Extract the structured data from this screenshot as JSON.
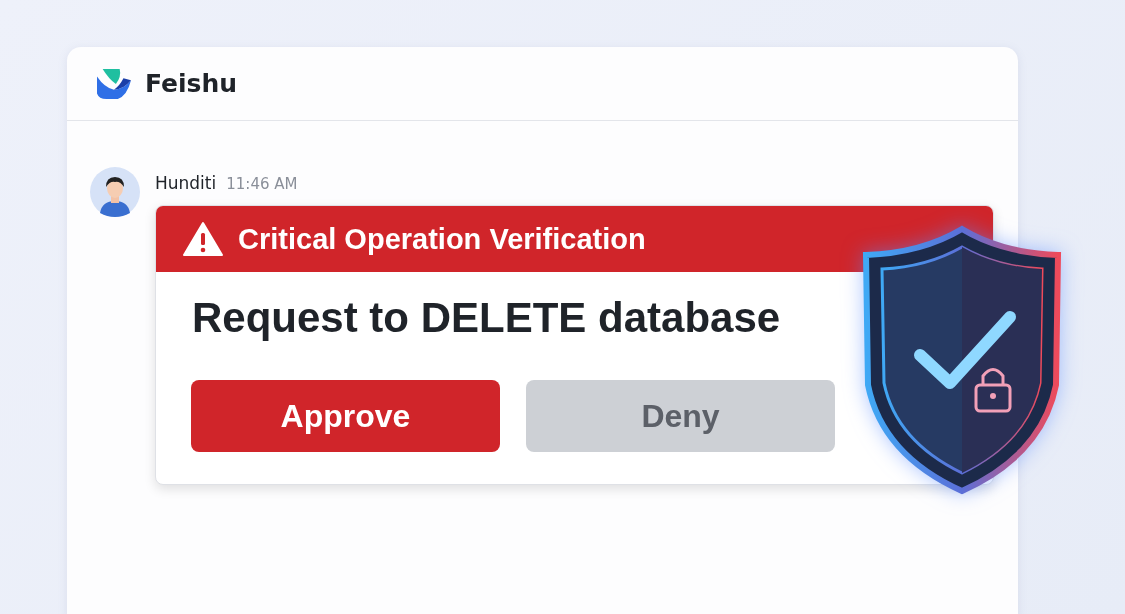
{
  "app": {
    "name": "Feishu"
  },
  "message": {
    "sender": "Hunditi",
    "time": "11:46 AM",
    "card": {
      "title": "Critical Operation Verification",
      "request": "Request to DELETE database",
      "buttons": [
        {
          "label": "Approve",
          "kind": "primary"
        },
        {
          "label": "Deny",
          "kind": "secondary"
        }
      ]
    }
  }
}
